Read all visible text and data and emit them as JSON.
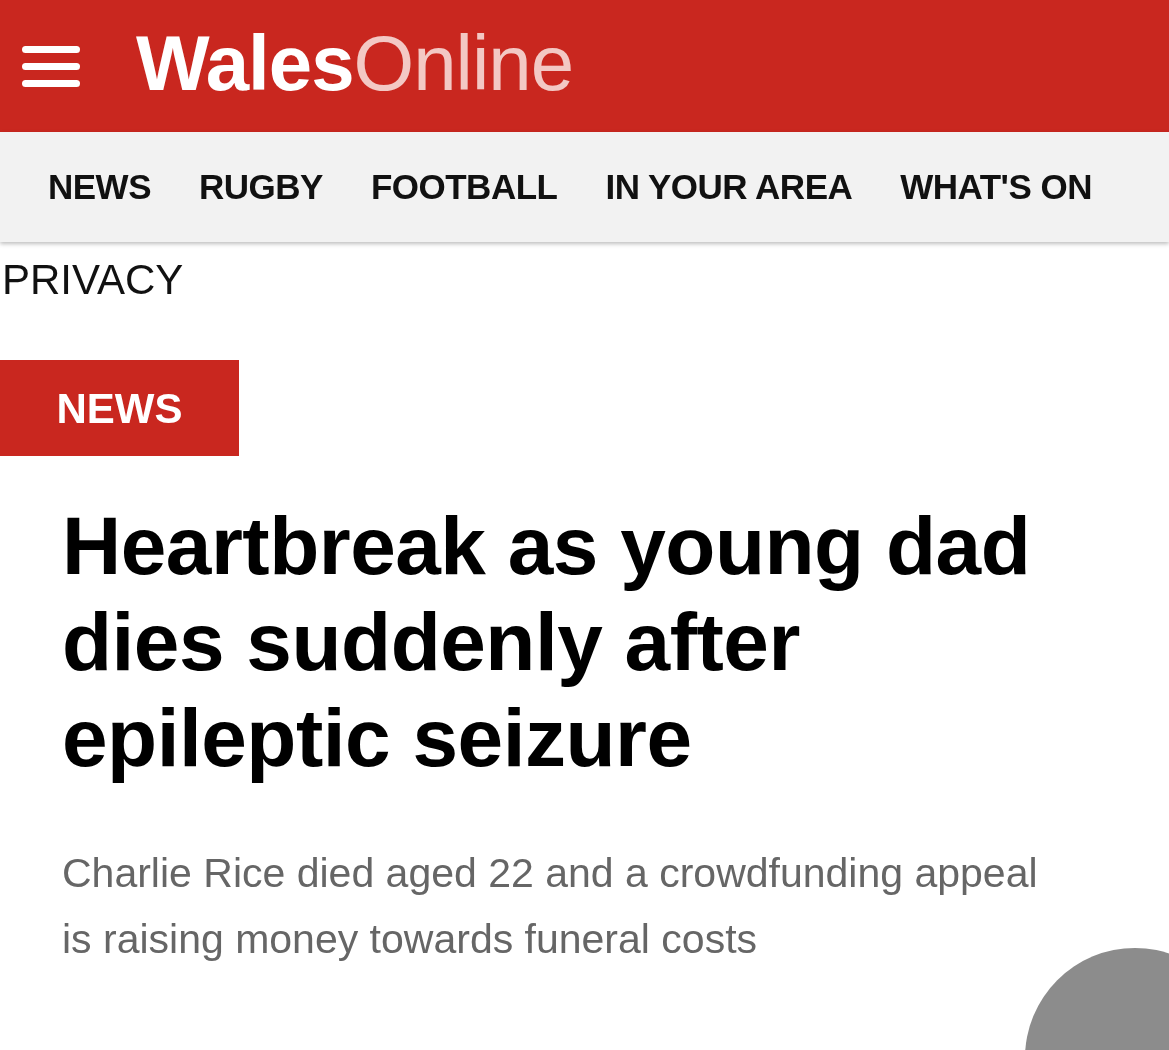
{
  "header": {
    "logo_bold": "Wales",
    "logo_light": "Online"
  },
  "nav": {
    "items": [
      {
        "label": "NEWS"
      },
      {
        "label": "RUGBY"
      },
      {
        "label": "FOOTBALL"
      },
      {
        "label": "IN YOUR AREA"
      },
      {
        "label": "WHAT'S ON"
      }
    ]
  },
  "privacy_link": "PRIVACY",
  "article": {
    "section_tag": "NEWS",
    "headline": "Heartbreak as young dad dies suddenly after epileptic seizure",
    "standfirst": "Charlie Rice died aged 22 and a crowdfunding appeal is raising money towards funeral costs"
  }
}
